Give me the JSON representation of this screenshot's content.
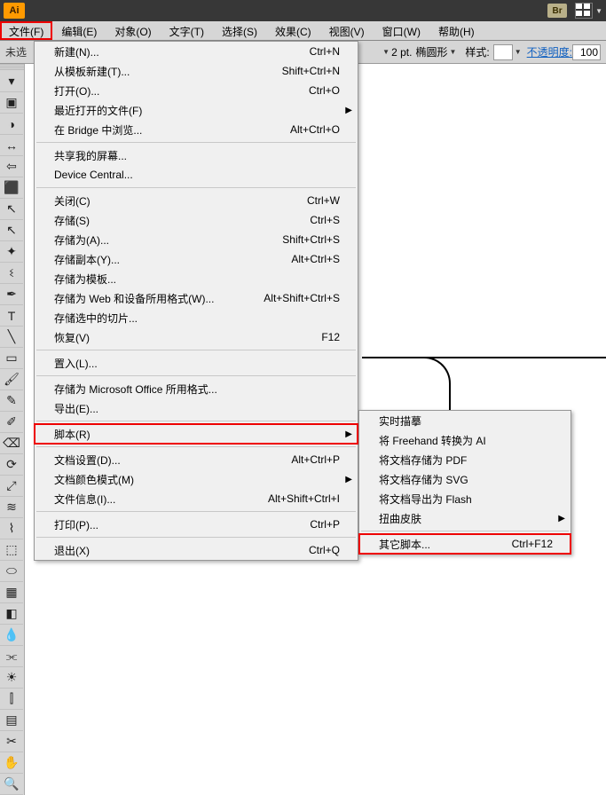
{
  "topbar": {
    "logo": "Ai",
    "br": "Br"
  },
  "menubar": {
    "items": [
      "文件(F)",
      "编辑(E)",
      "对象(O)",
      "文字(T)",
      "选择(S)",
      "效果(C)",
      "视图(V)",
      "窗口(W)",
      "帮助(H)"
    ]
  },
  "secondbar": {
    "left": "未选",
    "stroke_val": "2 pt.",
    "stroke_shape": "椭圆形",
    "style_label": "样式:",
    "opacity_label": "不透明度:",
    "opacity_val": "100"
  },
  "file_menu": [
    {
      "label": "新建(N)...",
      "shortcut": "Ctrl+N"
    },
    {
      "label": "从模板新建(T)...",
      "shortcut": "Shift+Ctrl+N"
    },
    {
      "label": "打开(O)...",
      "shortcut": "Ctrl+O"
    },
    {
      "label": "最近打开的文件(F)",
      "submenu": true
    },
    {
      "label": "在 Bridge 中浏览...",
      "shortcut": "Alt+Ctrl+O"
    },
    {
      "sep": true
    },
    {
      "label": "共享我的屏幕..."
    },
    {
      "label": "Device Central..."
    },
    {
      "sep": true
    },
    {
      "label": "关闭(C)",
      "shortcut": "Ctrl+W"
    },
    {
      "label": "存储(S)",
      "shortcut": "Ctrl+S"
    },
    {
      "label": "存储为(A)...",
      "shortcut": "Shift+Ctrl+S"
    },
    {
      "label": "存储副本(Y)...",
      "shortcut": "Alt+Ctrl+S"
    },
    {
      "label": "存储为模板..."
    },
    {
      "label": "存储为 Web 和设备所用格式(W)...",
      "shortcut": "Alt+Shift+Ctrl+S"
    },
    {
      "label": "存储选中的切片..."
    },
    {
      "label": "恢复(V)",
      "shortcut": "F12"
    },
    {
      "sep": true
    },
    {
      "label": "置入(L)..."
    },
    {
      "sep": true
    },
    {
      "label": "存储为 Microsoft Office 所用格式..."
    },
    {
      "label": "导出(E)..."
    },
    {
      "sep": true
    },
    {
      "label": "脚本(R)",
      "submenu": true,
      "highlight": true
    },
    {
      "sep": true
    },
    {
      "label": "文档设置(D)...",
      "shortcut": "Alt+Ctrl+P"
    },
    {
      "label": "文档颜色模式(M)",
      "submenu": true
    },
    {
      "label": "文件信息(I)...",
      "shortcut": "Alt+Shift+Ctrl+I"
    },
    {
      "sep": true
    },
    {
      "label": "打印(P)...",
      "shortcut": "Ctrl+P"
    },
    {
      "sep": true
    },
    {
      "label": "退出(X)",
      "shortcut": "Ctrl+Q"
    }
  ],
  "script_menu": [
    {
      "label": "实时描摹"
    },
    {
      "label": "将 Freehand 转换为 AI"
    },
    {
      "label": "将文档存储为 PDF"
    },
    {
      "label": "将文档存储为 SVG"
    },
    {
      "label": "将文档导出为 Flash"
    },
    {
      "label": "扭曲皮肤",
      "submenu": true
    },
    {
      "sep": true
    },
    {
      "label": "其它脚本...",
      "shortcut": "Ctrl+F12",
      "highlight": true
    }
  ],
  "tools": [
    "grip",
    "▾",
    "▣",
    "◑",
    "↔",
    "⇦",
    "⬛",
    "cursor",
    "direct",
    "magic",
    "lasso",
    "pen",
    "type",
    "line",
    "rect",
    "brush",
    "pencil",
    "blob",
    "eraser",
    "rotate",
    "scale",
    "width",
    "warp",
    "freet",
    "shape",
    "mesh",
    "grad",
    "eyedrop",
    "blend",
    "symbol",
    "graph",
    "artb",
    "slice",
    "hand",
    "zoom"
  ]
}
